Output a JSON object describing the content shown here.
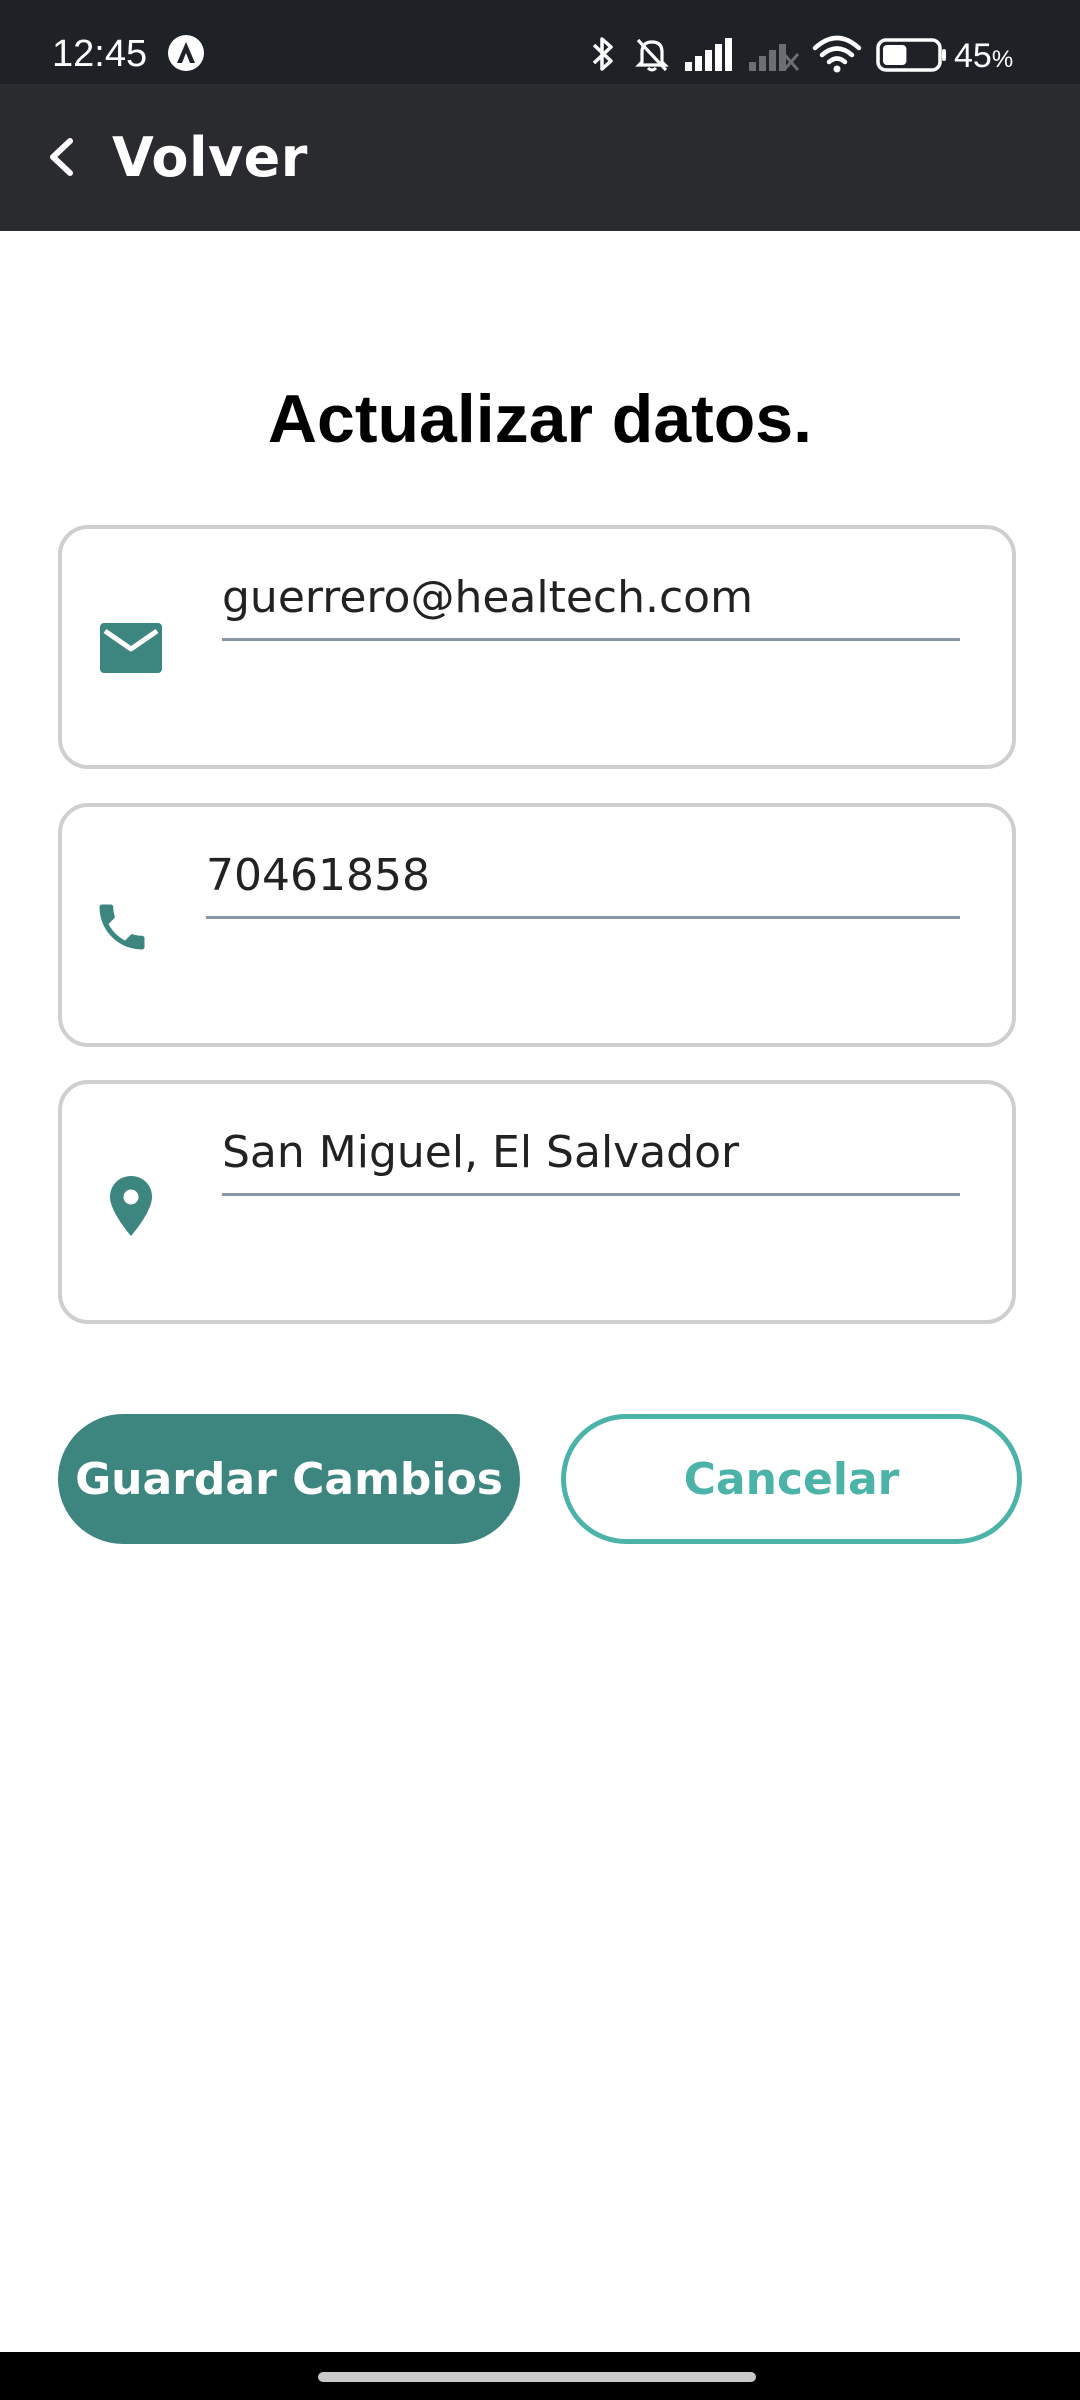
{
  "status_bar": {
    "time": "12:45",
    "battery_percent": "45",
    "battery_unit": "%",
    "battery_level": 0.45,
    "icons": [
      "app-notification-icon",
      "bluetooth-icon",
      "silent-bell-icon",
      "signal-icon",
      "signal-off-icon",
      "wifi-icon",
      "battery-icon"
    ]
  },
  "app_bar": {
    "back_label": "Volver",
    "back_icon": "chevron-left-icon"
  },
  "form": {
    "title": "Actualizar datos.",
    "fields": [
      {
        "icon": "email-icon",
        "value": "guerrero@healtech.com"
      },
      {
        "icon": "phone-icon",
        "value": "70461858"
      },
      {
        "icon": "location-pin-icon",
        "value": "San Miguel, El Salvador"
      }
    ]
  },
  "actions": {
    "save_label": "Guardar Cambios",
    "cancel_label": "Cancelar"
  },
  "colors": {
    "primary": "#3d8680",
    "accent_outline": "#4cb3a8",
    "app_bar": "#2a2b2f",
    "status_bar": "#1e2126"
  }
}
